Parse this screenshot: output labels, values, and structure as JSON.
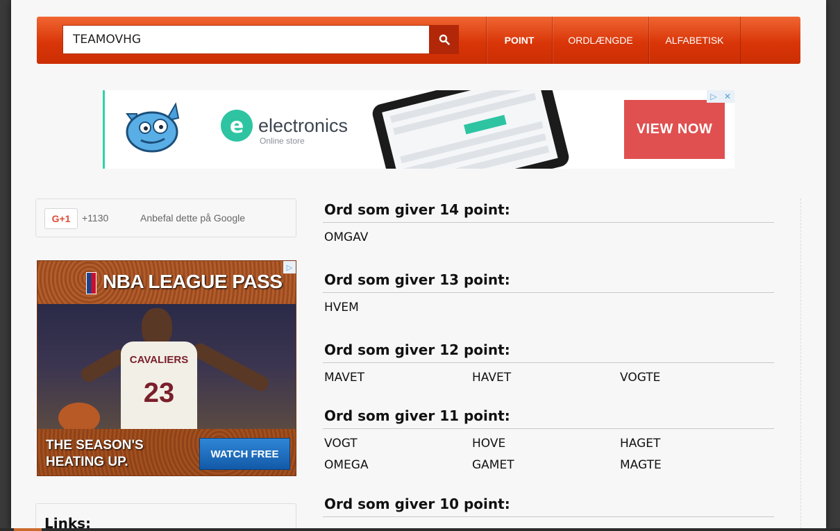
{
  "search": {
    "value": "TEAMOVHG",
    "button_icon": "search-icon"
  },
  "nav": {
    "items": [
      {
        "label": "POINT",
        "active": true
      },
      {
        "label": "ORDLÆNGDE",
        "active": false
      },
      {
        "label": "ALFABETISK",
        "active": false
      }
    ]
  },
  "colors": {
    "accent": "#de3b0c",
    "button_dark": "#b22708",
    "ad_button": "#e05050",
    "electronics_green": "#2ec4a2"
  },
  "banner_ad": {
    "logo_letter": "e",
    "brand": "electronics",
    "sub": "Online store",
    "cta": "VIEW NOW"
  },
  "gplus": {
    "button": "G+1",
    "count": "+1130",
    "text": "Anbefal dette på Google"
  },
  "nba_ad": {
    "title": "NBA LEAGUE PASS",
    "jersey_text": "CAVALIERS",
    "jersey_number": "23",
    "tagline": "THE SEASON'S HEATING UP.",
    "cta": "WATCH FREE"
  },
  "links": {
    "title": "Links:"
  },
  "results": [
    {
      "heading": "Ord som giver 14 point:",
      "words": [
        "OMGAV"
      ]
    },
    {
      "heading": "Ord som giver 13 point:",
      "words": [
        "HVEM"
      ]
    },
    {
      "heading": "Ord som giver 12 point:",
      "words": [
        "MAVET",
        "HAVET",
        "VOGTE"
      ]
    },
    {
      "heading": "Ord som giver 11 point:",
      "words": [
        "VOGT",
        "HOVE",
        "HAGET",
        "OMEGA",
        "GAMET",
        "MAGTE"
      ]
    },
    {
      "heading": "Ord som giver 10 point:",
      "words": []
    }
  ]
}
